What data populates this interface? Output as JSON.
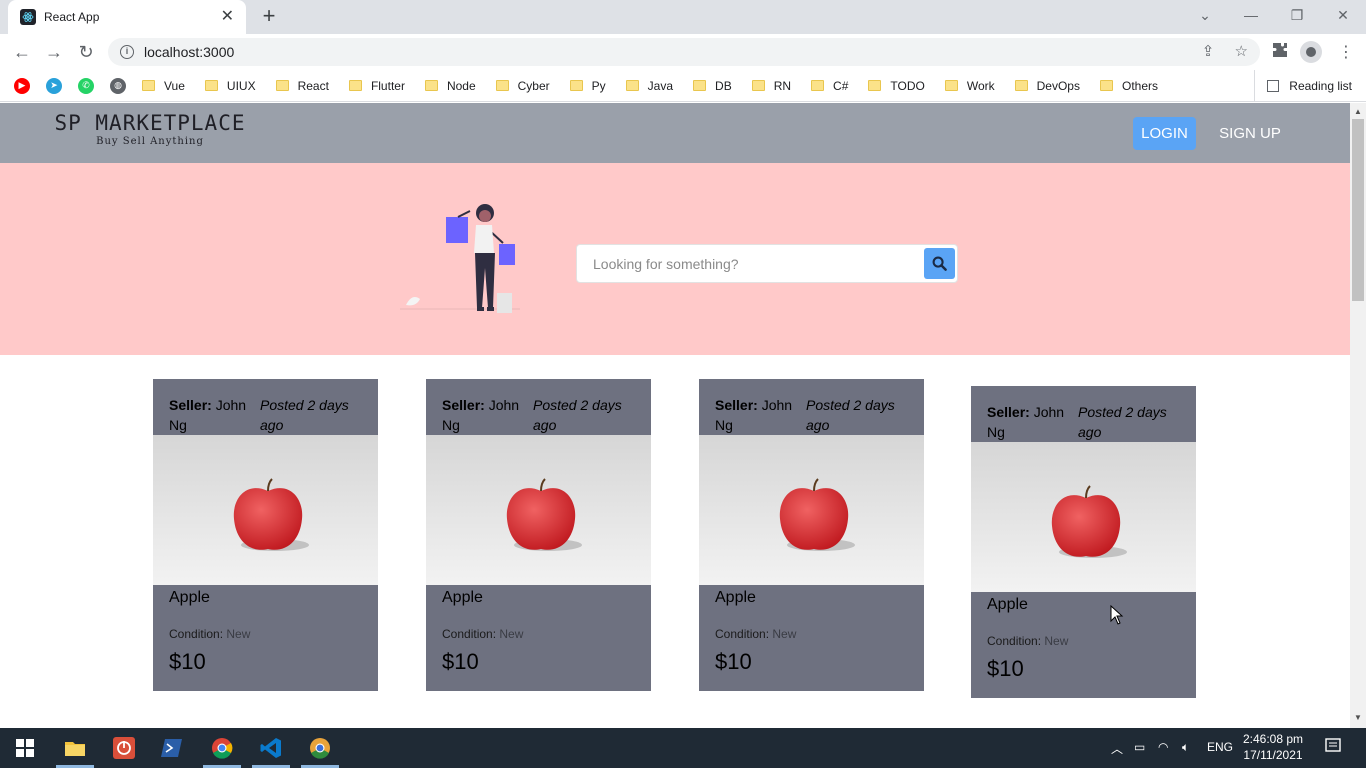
{
  "browser": {
    "tab_title": "React App",
    "url": "localhost:3000",
    "bookmarks": [
      "Vue",
      "UIUX",
      "React",
      "Flutter",
      "Node",
      "Cyber",
      "Py",
      "Java",
      "DB",
      "RN",
      "C#",
      "TODO",
      "Work",
      "DevOps",
      "Others"
    ],
    "reading_list": "Reading list"
  },
  "site": {
    "logo_title": "SP MARKETPLACE",
    "logo_tagline": "Buy Sell Anything",
    "login_label": "LOGIN",
    "signup_label": "SIGN UP"
  },
  "search": {
    "placeholder": "Looking for something?"
  },
  "listings": [
    {
      "seller_label": "Seller:",
      "seller_name": "John Ng",
      "posted": "Posted 2 days ago",
      "title": "Apple",
      "condition_label": "Condition:",
      "condition": "New",
      "price": "$10"
    },
    {
      "seller_label": "Seller:",
      "seller_name": "John Ng",
      "posted": "Posted 2 days ago",
      "title": "Apple",
      "condition_label": "Condition:",
      "condition": "New",
      "price": "$10"
    },
    {
      "seller_label": "Seller:",
      "seller_name": "John Ng",
      "posted": "Posted 2 days ago",
      "title": "Apple",
      "condition_label": "Condition:",
      "condition": "New",
      "price": "$10"
    },
    {
      "seller_label": "Seller:",
      "seller_name": "John Ng",
      "posted": "Posted 2 days ago",
      "title": "Apple",
      "condition_label": "Condition:",
      "condition": "New",
      "price": "$10"
    }
  ],
  "taskbar": {
    "language": "ENG",
    "time": "2:46:08 pm",
    "date": "17/11/2021"
  },
  "colors": {
    "header": "#9aa0aa",
    "hero": "#ffc9c9",
    "accent": "#5aa4f5",
    "card": "#6e7180"
  }
}
